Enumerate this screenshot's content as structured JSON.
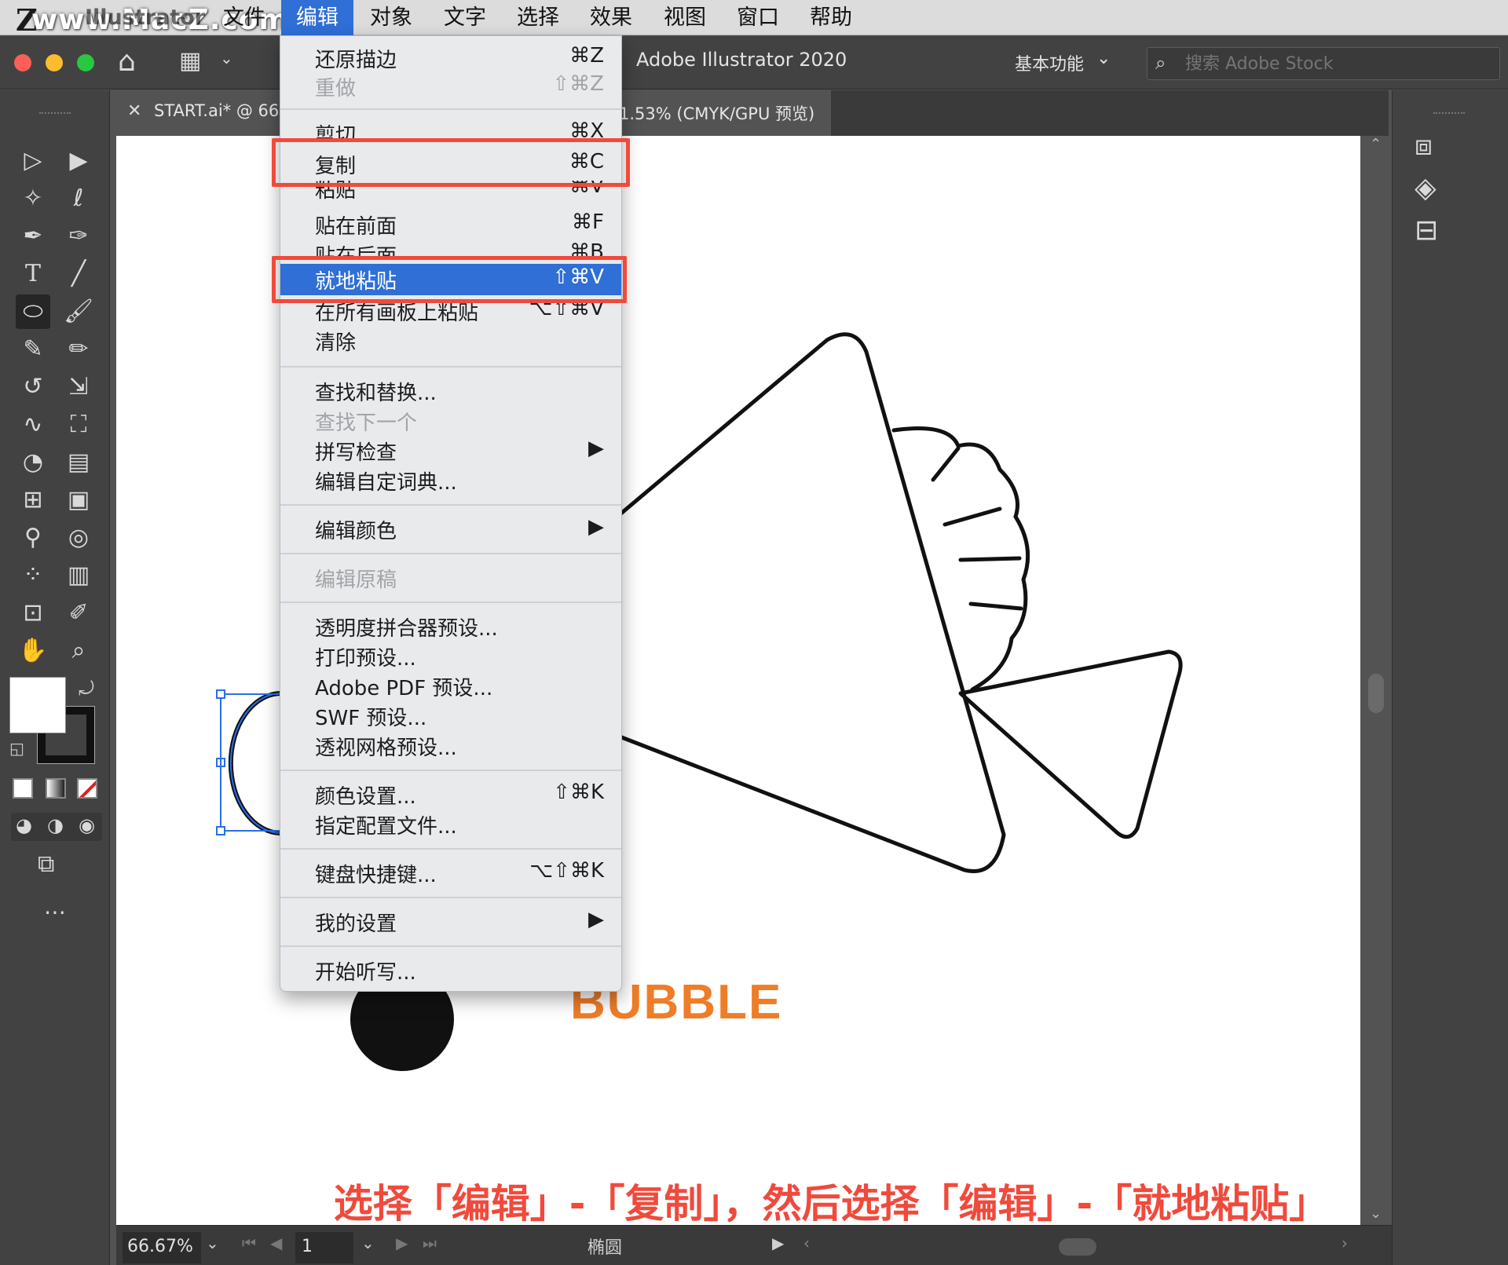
{
  "menubar": {
    "watermark": "www.MacZ.com",
    "logo": "Z",
    "app_name": "Illustrator",
    "items": [
      "文件",
      "编辑",
      "对象",
      "文字",
      "选择",
      "效果",
      "视图",
      "窗口",
      "帮助"
    ]
  },
  "appbar": {
    "title": "Adobe Illustrator 2020",
    "workspace": "基本功能",
    "search_placeholder": "搜索 Adobe Stock"
  },
  "doc_tab": {
    "name_prefix": "START.ai* @ 66.6",
    "name_suffix": "1.53% (CMYK/GPU 预览)"
  },
  "edit_menu": {
    "items": [
      {
        "label": "还原描边",
        "shortcut": "⌘Z",
        "disabled": false
      },
      {
        "label": "重做",
        "shortcut": "⇧⌘Z",
        "disabled": true
      },
      {
        "label": "剪切",
        "shortcut": "⌘X",
        "disabled": false
      },
      {
        "label": "复制",
        "shortcut": "⌘C",
        "disabled": false
      },
      {
        "label": "粘贴",
        "shortcut": "⌘V",
        "disabled": false
      },
      {
        "label": "贴在前面",
        "shortcut": "⌘F",
        "disabled": false
      },
      {
        "label": "贴在后面",
        "shortcut": "⌘B",
        "disabled": false
      },
      {
        "label": "就地粘贴",
        "shortcut": "⇧⌘V",
        "disabled": false
      },
      {
        "label": "在所有画板上粘贴",
        "shortcut": "⌥⇧⌘V",
        "disabled": false
      },
      {
        "label": "清除",
        "shortcut": "",
        "disabled": false
      },
      {
        "label": "查找和替换...",
        "shortcut": "",
        "disabled": false
      },
      {
        "label": "查找下一个",
        "shortcut": "",
        "disabled": true
      },
      {
        "label": "拼写检查",
        "shortcut": "▶",
        "disabled": false
      },
      {
        "label": "编辑自定词典...",
        "shortcut": "",
        "disabled": false
      },
      {
        "label": "编辑颜色",
        "shortcut": "▶",
        "disabled": false
      },
      {
        "label": "编辑原稿",
        "shortcut": "",
        "disabled": true
      },
      {
        "label": "透明度拼合器预设...",
        "shortcut": "",
        "disabled": false
      },
      {
        "label": "打印预设...",
        "shortcut": "",
        "disabled": false
      },
      {
        "label": "Adobe PDF 预设...",
        "shortcut": "",
        "disabled": false
      },
      {
        "label": "SWF 预设...",
        "shortcut": "",
        "disabled": false
      },
      {
        "label": "透视网格预设...",
        "shortcut": "",
        "disabled": false
      },
      {
        "label": "颜色设置...",
        "shortcut": "⇧⌘K",
        "disabled": false
      },
      {
        "label": "指定配置文件...",
        "shortcut": "",
        "disabled": false
      },
      {
        "label": "键盘快捷键...",
        "shortcut": "⌥⇧⌘K",
        "disabled": false
      },
      {
        "label": "我的设置",
        "shortcut": "▶",
        "disabled": false
      },
      {
        "label": "开始听写...",
        "shortcut": "",
        "disabled": false
      }
    ]
  },
  "canvas": {
    "bubble_label": "BUBBLE",
    "caption": "选择「编辑」-「复制」，然后选择「编辑」-「就地粘贴」"
  },
  "statusbar": {
    "zoom": "66.67%",
    "page": "1",
    "tool_name": "椭圆"
  },
  "colors": {
    "menu_highlight": "#2f6fd6",
    "annotation_red": "#f04a3c",
    "bubble_orange": "#ef7d27"
  },
  "icons": {
    "tools": [
      "selection-tool-icon",
      "direct-selection-tool-icon",
      "magic-wand-icon",
      "lasso-icon",
      "pen-tool-icon",
      "curvature-tool-icon",
      "type-tool-icon",
      "line-tool-icon",
      "ellipse-tool-icon",
      "paintbrush-icon",
      "shaper-tool-icon",
      "pencil-tool-icon",
      "rotate-tool-icon",
      "scale-tool-icon",
      "warp-tool-icon",
      "free-transform-icon",
      "shape-builder-icon",
      "perspective-grid-icon",
      "mesh-tool-icon",
      "gradient-tool-icon",
      "eyedropper-icon",
      "blend-tool-icon",
      "symbol-sprayer-icon",
      "column-graph-icon",
      "artboard-tool-icon",
      "slice-tool-icon",
      "hand-tool-icon",
      "zoom-tool-icon"
    ],
    "right_panel": [
      "properties-icon",
      "layers-icon",
      "libraries-icon"
    ]
  }
}
